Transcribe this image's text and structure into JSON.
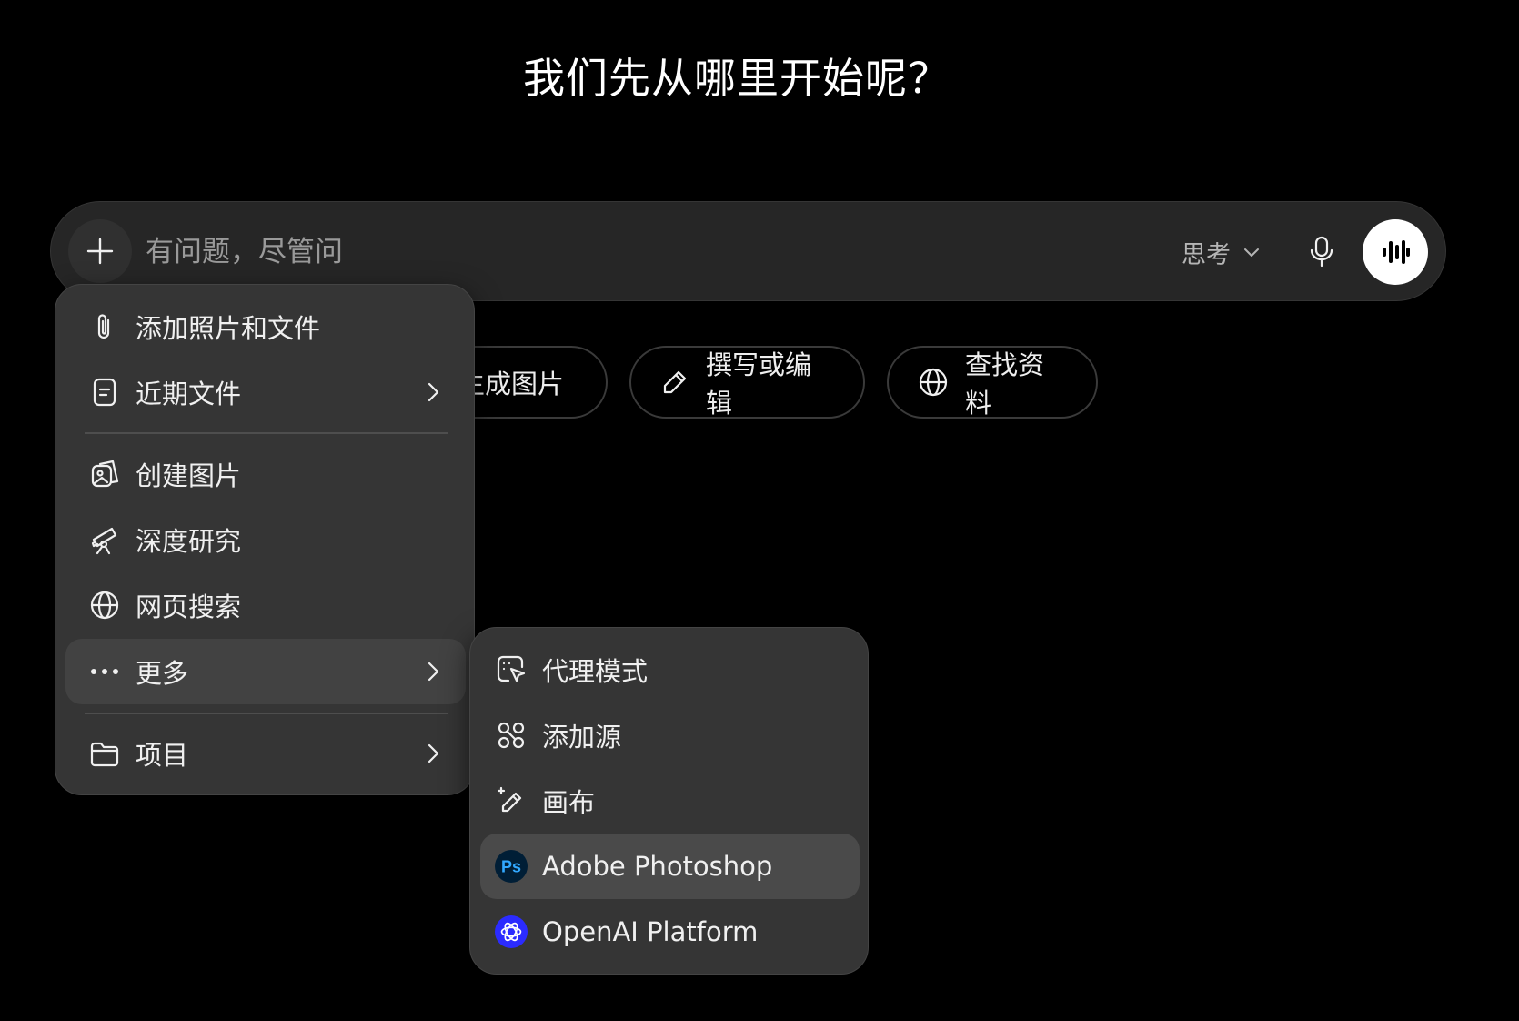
{
  "headline": "我们先从哪里开始呢？",
  "composer": {
    "placeholder": "有问题，尽管问",
    "think_label": "思考"
  },
  "suggestions": [
    {
      "label": "生成图片",
      "icon": "image-icon"
    },
    {
      "label": "撰写或编辑",
      "icon": "pencil-icon"
    },
    {
      "label": "查找资料",
      "icon": "globe-icon"
    }
  ],
  "menu": {
    "items": [
      {
        "label": "添加照片和文件",
        "icon": "paperclip-icon"
      },
      {
        "label": "近期文件",
        "icon": "document-icon",
        "submenu": true
      },
      {
        "label": "创建图片",
        "icon": "create-image-icon"
      },
      {
        "label": "深度研究",
        "icon": "telescope-icon"
      },
      {
        "label": "网页搜索",
        "icon": "globe-icon"
      },
      {
        "label": "更多",
        "icon": "more-dots-icon",
        "submenu": true,
        "highlighted": true
      },
      {
        "label": "项目",
        "icon": "folder-icon",
        "submenu": true
      }
    ]
  },
  "submenu": {
    "items": [
      {
        "label": "代理模式",
        "icon": "agent-cursor-icon"
      },
      {
        "label": "添加源",
        "icon": "sources-icon"
      },
      {
        "label": "画布",
        "icon": "canvas-pencil-icon"
      },
      {
        "label": "Adobe Photoshop",
        "icon": "photoshop-icon",
        "icon_text": "Ps",
        "highlighted": true
      },
      {
        "label": "OpenAI Platform",
        "icon": "openai-icon"
      }
    ]
  },
  "colors": {
    "background": "#000000",
    "composer": "#262626",
    "menu": "#353535",
    "highlight": "#4a4a4a",
    "photoshop_bg": "#001e36",
    "photoshop_fg": "#31a8ff",
    "openai_bg": "#2b2bff"
  }
}
